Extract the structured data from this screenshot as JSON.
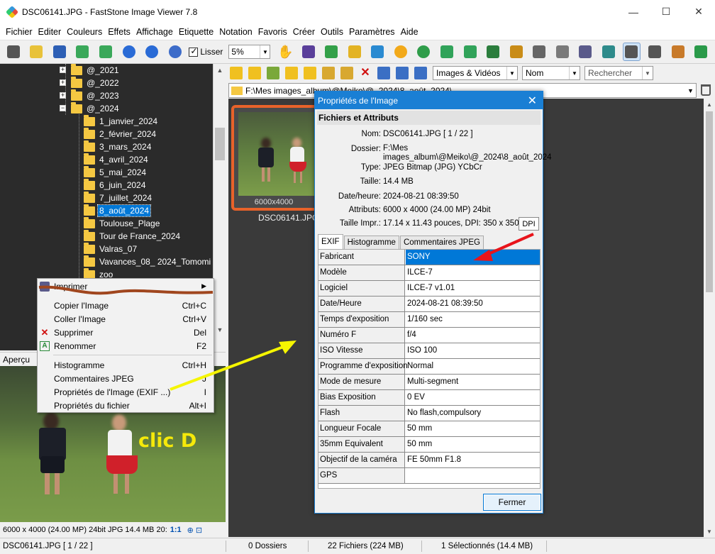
{
  "window": {
    "title": "DSC06141.JPG  -  FastStone Image Viewer 7.8",
    "minimize": "—",
    "maximize": "☐",
    "close": "✕"
  },
  "menu": [
    "Fichier",
    "Editer",
    "Couleurs",
    "Effets",
    "Affichage",
    "Etiquette",
    "Notation",
    "Favoris",
    "Créer",
    "Outils",
    "Paramètres",
    "Aide"
  ],
  "toolbar": {
    "smooth_label": "Lisser",
    "zoom_value": "5%"
  },
  "tree": {
    "items": [
      {
        "label": "@_2021",
        "expander": "+"
      },
      {
        "label": "@_2022",
        "expander": "+"
      },
      {
        "label": "@_2023",
        "expander": "+"
      },
      {
        "label": "@_2024",
        "expander": "−"
      },
      {
        "label": "1_janvier_2024"
      },
      {
        "label": "2_février_2024"
      },
      {
        "label": "3_mars_2024"
      },
      {
        "label": "4_avril_2024"
      },
      {
        "label": "5_mai_2024"
      },
      {
        "label": "6_juin_2024"
      },
      {
        "label": "7_juillet_2024"
      },
      {
        "label": "8_août_2024",
        "selected": true
      },
      {
        "label": "Toulouse_Plage"
      },
      {
        "label": "Tour de France_2024"
      },
      {
        "label": "Valras_07"
      },
      {
        "label": "Vavances_08_ 2024_Tomomi"
      },
      {
        "label": "zoo"
      }
    ]
  },
  "preview": {
    "header": "Aperçu",
    "info": "6000 x 4000 (24.00 MP)  24bit  JPG  14.4 MB  20:",
    "zoom": "1:1"
  },
  "browser": {
    "filter": "Images & Vidéos",
    "sort": "Nom",
    "search_placeholder": "Rechercher",
    "path": "F:\\Mes images_album\\@Meiko\\@_2024\\8_août_2024\\",
    "thumb_resolution": "6000x4000",
    "thumb_name": "DSC06141.JPG"
  },
  "context_menu": {
    "items": [
      {
        "label": "Imprimer",
        "shortcut": "",
        "submenu": true
      },
      {
        "label": "Copier l'Image",
        "shortcut": "Ctrl+C"
      },
      {
        "label": "Coller l'Image",
        "shortcut": "Ctrl+V"
      },
      {
        "label": "Supprimer",
        "shortcut": "Del"
      },
      {
        "label": "Renommer",
        "shortcut": "F2"
      },
      {
        "label": "Histogramme",
        "shortcut": "Ctrl+H"
      },
      {
        "label": "Commentaires JPEG",
        "shortcut": "J"
      },
      {
        "label": "Propriétés de l'Image (EXIF ...)",
        "shortcut": "I"
      },
      {
        "label": "Propriétés du fichier",
        "shortcut": "Alt+I"
      }
    ]
  },
  "dialog": {
    "title": "Propriétés de l'Image",
    "section": "Fichiers et Attributs",
    "attributes": [
      {
        "label": "Nom:",
        "value": "DSC06141.JPG    [ 1 / 22 ]"
      },
      {
        "label": "Dossier:",
        "value": "F:\\Mes",
        "value2": "images_album\\@Meiko\\@_2024\\8_août_2024"
      },
      {
        "label": "Type:",
        "value": "JPEG Bitmap (JPG) YCbCr"
      },
      {
        "label": "Taille:",
        "value": "14.4 MB"
      },
      {
        "label": "Date/heure:",
        "value": "2024-08-21 08:39:50"
      },
      {
        "label": "Attributs:",
        "value": "6000 x 4000 (24.00 MP)  24bit"
      },
      {
        "label": "Taille Impr.:",
        "value": "17.14 x 11.43 pouces,  DPI: 350 x 350"
      }
    ],
    "dpi_button": "DPI",
    "tabs": [
      "EXIF",
      "Histogramme",
      "Commentaires JPEG"
    ],
    "exif": [
      {
        "key": "Fabricant",
        "value": "SONY"
      },
      {
        "key": "Modèle",
        "value": "ILCE-7"
      },
      {
        "key": "Logiciel",
        "value": "ILCE-7 v1.01"
      },
      {
        "key": "Date/Heure",
        "value": "2024-08-21 08:39:50"
      },
      {
        "key": "Temps d'exposition",
        "value": "1/160 sec"
      },
      {
        "key": "Numéro F",
        "value": "f/4"
      },
      {
        "key": "ISO Vitesse",
        "value": "ISO 100"
      },
      {
        "key": "Programme d'exposition",
        "value": "Normal"
      },
      {
        "key": "Mode de mesure",
        "value": "Multi-segment"
      },
      {
        "key": "Bias Exposition",
        "value": "0 EV"
      },
      {
        "key": "Flash",
        "value": "No flash,compulsory"
      },
      {
        "key": "Longueur Focale",
        "value": "50 mm"
      },
      {
        "key": "35mm Equivalent",
        "value": "50 mm"
      },
      {
        "key": "Objectif de la caméra",
        "value": "FE 50mm F1.8"
      },
      {
        "key": "GPS",
        "value": ""
      }
    ],
    "close_button": "Fermer"
  },
  "statusbar": {
    "file": "DSC06141.JPG [ 1 / 22 ]",
    "folders": "0 Dossiers",
    "files": "22 Fichiers (224 MB)",
    "selected": "1 Sélectionnés (14.4 MB)"
  },
  "annotation": {
    "label": "clic D",
    "arrow_colors": {
      "yellow": "#f5f500",
      "red": "#e8141b",
      "brown": "#a0461e"
    }
  }
}
